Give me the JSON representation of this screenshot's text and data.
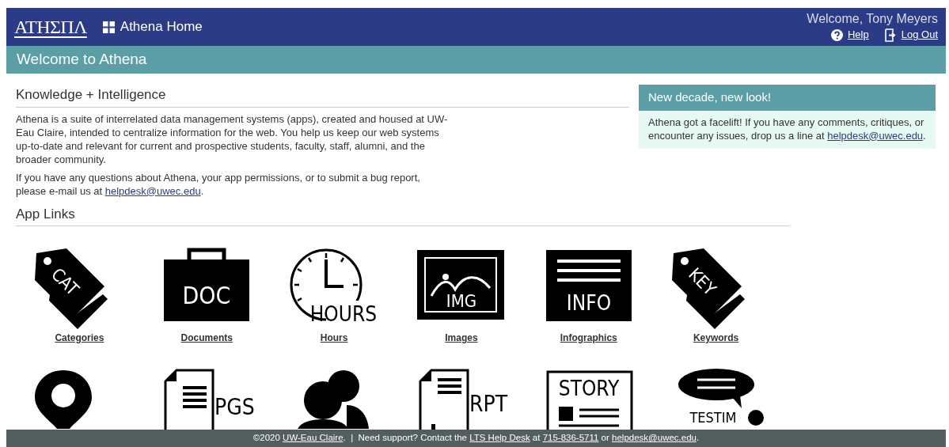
{
  "header": {
    "logo": "ΑΤΗΣΠΛ",
    "home_link": "Athena Home",
    "welcome": "Welcome, Tony Meyers",
    "links": [
      {
        "kind": "help",
        "label": "Help"
      },
      {
        "kind": "logout",
        "label": "Log Out"
      }
    ]
  },
  "page_title": "Welcome to Athena",
  "intro": {
    "heading": "Knowledge + Intelligence",
    "paragraphs": [
      {
        "parts": [
          {
            "text": "Athena is a suite of interrelated data management systems (apps), created and housed at UW-Eau Claire, intended to centralize information for the web. You help us keep our web systems up-to-date and relevant for current and prospective students, faculty, staff, alumni, and the broader community."
          }
        ]
      },
      {
        "parts": [
          {
            "text": "If you have any questions about Athena, your app permissions, or to submit a bug report, please e-mail us at "
          },
          {
            "link": "helpdesk@uwec.edu"
          },
          {
            "text": "."
          }
        ]
      }
    ]
  },
  "news": {
    "title": "New decade, new look!",
    "parts": [
      {
        "text": "Athena got a facelift! If you have any comments, critiques, or encounter any issues, drop us a line at "
      },
      {
        "link": "helpdesk@uwec.edu"
      },
      {
        "text": "."
      }
    ]
  },
  "apps_heading": "App Links",
  "apps": [
    {
      "kind": "tag",
      "icon_text": "CAT",
      "label": "Categories"
    },
    {
      "kind": "briefcase",
      "icon_text": "DOC",
      "label": "Documents"
    },
    {
      "kind": "clock",
      "icon_text": "HOURS",
      "label": "Hours"
    },
    {
      "kind": "frame",
      "icon_text": "IMG",
      "label": "Images"
    },
    {
      "kind": "board",
      "icon_text": "INFO",
      "label": "Infographics"
    },
    {
      "kind": "tag",
      "icon_text": "KEY",
      "label": "Keywords"
    },
    {
      "kind": "pin"
    },
    {
      "kind": "document",
      "icon_text": "PGS"
    },
    {
      "kind": "people"
    },
    {
      "kind": "report",
      "icon_text": "RPT"
    },
    {
      "kind": "newspaper",
      "icon_text": "STORY"
    },
    {
      "kind": "speech",
      "icon_text": "TESTIM"
    }
  ],
  "footer": {
    "parts": [
      {
        "text": "©2020 "
      },
      {
        "link": "UW-Eau Claire"
      },
      {
        "text": ".  |  Need support? Contact the "
      },
      {
        "link": "LTS Help Desk"
      },
      {
        "text": " at "
      },
      {
        "link": "715-836-5711"
      },
      {
        "text": " or "
      },
      {
        "link": "helpdesk@uwec.edu"
      },
      {
        "text": "."
      }
    ]
  }
}
